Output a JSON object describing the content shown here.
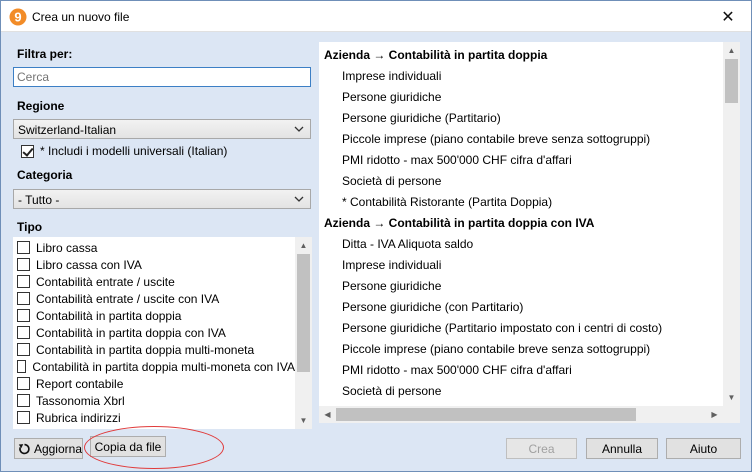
{
  "window": {
    "title": "Crea un nuovo file",
    "close_glyph": "✕",
    "app_icon": "app-logo-9-icon"
  },
  "filter": {
    "label": "Filtra per:",
    "search_placeholder": "Cerca",
    "search_value": ""
  },
  "region": {
    "label": "Regione",
    "selected": "Switzerland-Italian",
    "include_universal_label": "* Includi i modelli universali (Italian)",
    "include_universal_checked": true
  },
  "category": {
    "label": "Categoria",
    "selected": "- Tutto -"
  },
  "type": {
    "label": "Tipo",
    "items": [
      {
        "label": "Libro cassa",
        "checked": false
      },
      {
        "label": "Libro cassa con IVA",
        "checked": false
      },
      {
        "label": "Contabilità entrate / uscite",
        "checked": false
      },
      {
        "label": "Contabilità entrate / uscite con IVA",
        "checked": false
      },
      {
        "label": "Contabilità in partita doppia",
        "checked": false
      },
      {
        "label": "Contabilità in partita doppia con IVA",
        "checked": false
      },
      {
        "label": "Contabilità in partita doppia multi-moneta",
        "checked": false
      },
      {
        "label": "Contabilità in partita doppia multi-moneta con IVA",
        "checked": false
      },
      {
        "label": "Report contabile",
        "checked": false
      },
      {
        "label": "Tassonomia Xbrl",
        "checked": false
      },
      {
        "label": "Rubrica indirizzi",
        "checked": false
      }
    ]
  },
  "templates": {
    "rows": [
      {
        "kind": "header",
        "text": "Azienda → Contabilità in partita doppia"
      },
      {
        "kind": "item",
        "text": "Imprese individuali"
      },
      {
        "kind": "item",
        "text": "Persone giuridiche"
      },
      {
        "kind": "item",
        "text": "Persone giuridiche (Partitario)"
      },
      {
        "kind": "item",
        "text": "Piccole imprese (piano contabile breve senza sottogruppi)"
      },
      {
        "kind": "item",
        "text": "PMI ridotto - max 500'000 CHF cifra d'affari"
      },
      {
        "kind": "item",
        "text": "Società di persone"
      },
      {
        "kind": "item",
        "text": "* Contabilità Ristorante (Partita Doppia)"
      },
      {
        "kind": "header",
        "text": "Azienda → Contabilità in partita doppia con IVA"
      },
      {
        "kind": "item",
        "text": "Ditta - IVA Aliquota saldo"
      },
      {
        "kind": "item",
        "text": "Imprese individuali"
      },
      {
        "kind": "item",
        "text": "Persone giuridiche"
      },
      {
        "kind": "item",
        "text": "Persone giuridiche (con Partitario)"
      },
      {
        "kind": "item",
        "text": "Persone giuridiche (Partitario impostato con i centri di costo)"
      },
      {
        "kind": "item",
        "text": "Piccole imprese (piano contabile breve senza sottogruppi)"
      },
      {
        "kind": "item",
        "text": "PMI ridotto - max 500'000 CHF cifra d'affari"
      },
      {
        "kind": "item",
        "text": "Società di persone"
      }
    ]
  },
  "buttons": {
    "refresh": "Aggiorna",
    "copy_from_file": "Copia da file",
    "create": "Crea",
    "cancel": "Annulla",
    "help": "Aiuto"
  },
  "colors": {
    "dialog_background": "#dce6f4",
    "focus_border": "#3c7fc5",
    "annotation": "#e03b3b",
    "app_icon": "#f28c28"
  }
}
